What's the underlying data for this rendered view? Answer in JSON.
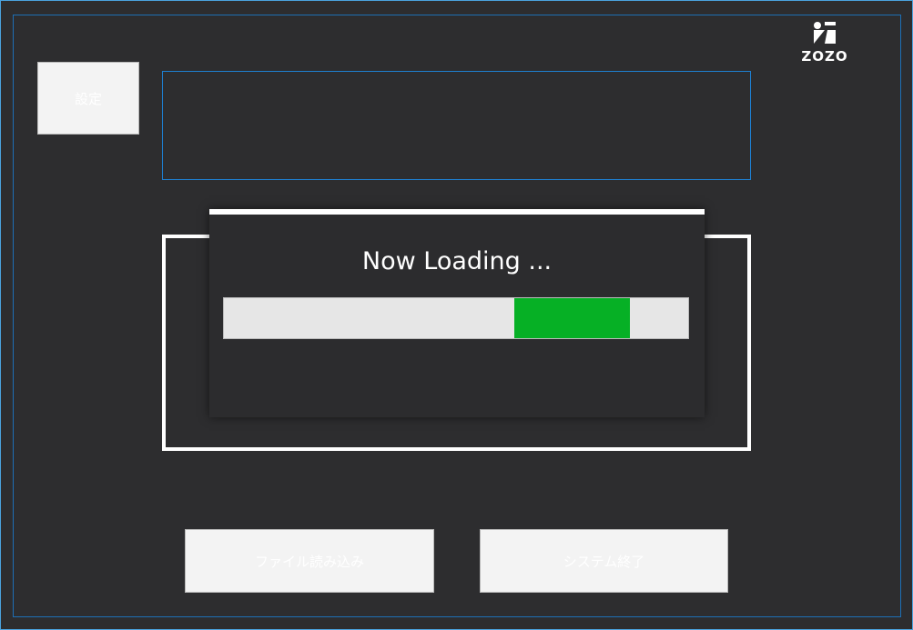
{
  "window": {
    "border_color": "#4aa3df",
    "inner_border_color": "#1e6fb5",
    "background": "#2d2d2f"
  },
  "logo": {
    "icon": "zozo-logo-icon",
    "text": "ZOZO"
  },
  "settings_button": {
    "label": "設定"
  },
  "output_box": {
    "text": ""
  },
  "loading_dialog": {
    "title": "Now Loading ...",
    "progress_color": "#06b025",
    "progress_indeterminate_segment_fraction": 0.25
  },
  "bottom_buttons": {
    "read_file_label": "ファイル読み込み",
    "exit_label": "システム終了"
  }
}
